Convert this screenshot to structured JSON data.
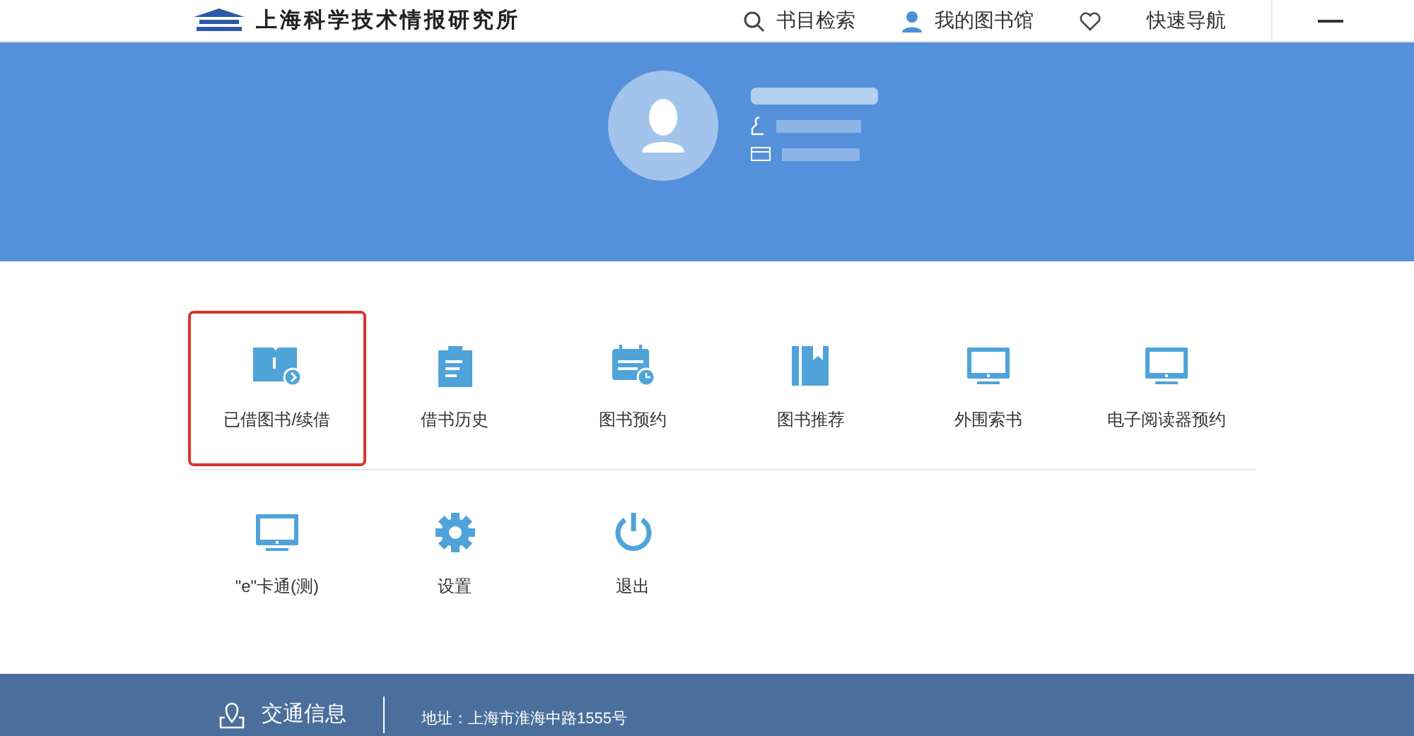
{
  "header": {
    "logo_text": "上海科学技术情报研究所",
    "nav": [
      {
        "label": "书目检索",
        "kind": "search"
      },
      {
        "label": "我的图书馆",
        "kind": "user"
      },
      {
        "kind": "heart"
      },
      {
        "label": "快速导航",
        "kind": "text"
      }
    ]
  },
  "menu_rows": [
    [
      {
        "label": "已借图书/续借",
        "kind": "book-arrow",
        "highlighted": true
      },
      {
        "label": "借书历史",
        "kind": "clipboard",
        "highlighted": false
      },
      {
        "label": "图书预约",
        "kind": "calendar",
        "highlighted": false
      },
      {
        "label": "图书推荐",
        "kind": "bookmark",
        "highlighted": false
      },
      {
        "label": "外围索书",
        "kind": "monitor",
        "highlighted": false
      },
      {
        "label": "电子阅读器预约",
        "kind": "monitor",
        "highlighted": false
      }
    ],
    [
      {
        "label": "\"e\"卡通(测)",
        "kind": "monitor",
        "highlighted": false
      },
      {
        "label": "设置",
        "kind": "gear",
        "highlighted": false
      },
      {
        "label": "退出",
        "kind": "power",
        "highlighted": false
      }
    ]
  ],
  "footer": {
    "title": "交通信息",
    "address": "地址：上海市淮海中路1555号"
  }
}
